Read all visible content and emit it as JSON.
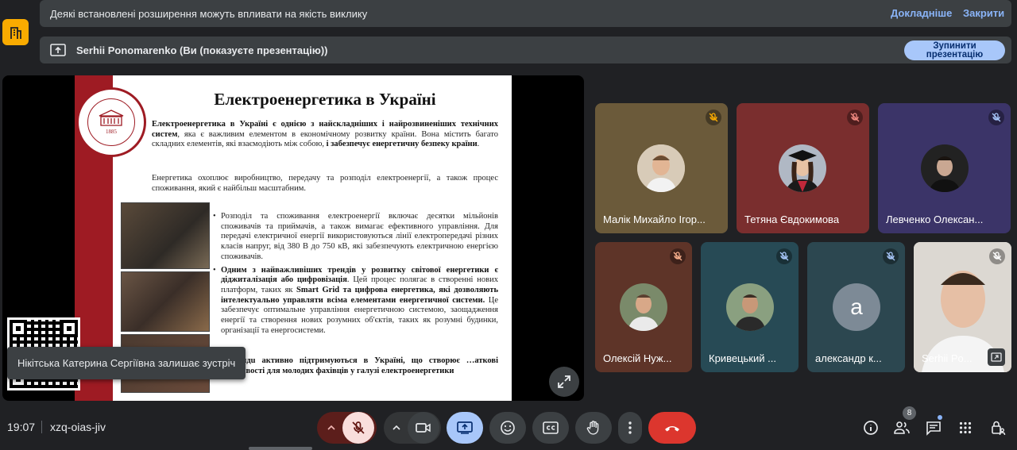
{
  "extensions_banner": {
    "text": "Деякі встановлені розширення можуть впливати на якість виклику",
    "details_link": "Докладніше",
    "close_link": "Закрити"
  },
  "presentation_banner": {
    "text": "Serhii Ponomarenko (Ви (показуєте презентацію))",
    "stop_line1": "Зупинити",
    "stop_line2": "презентацію"
  },
  "slide": {
    "title": "Електроенергетика в Україні",
    "logo_year": "1885",
    "p1_bold1": "Електроенергетика в Україні є однією з найскладніших і найрозвиненіших технічних систем",
    "p1_text1": ", яка є важливим елементом в економічному розвитку країни. Вона містить багато складних елементів, які взаємодіють між собою, ",
    "p1_bold2": "і забезпечує енергетичну безпеку країни",
    "p1_end": ".",
    "p2": "Енергетика охоплює виробництво, передачу та розподіл електроенергії, а також процес споживання, який є найбільш масштабним.",
    "b1": "Розподіл та споживання електроенергії включає десятки мільйонів споживачів та приймачів, а також вимагає ефективного управління. Для передачі електричної енергії використовуються лінії електропередачі різних класів напруг, від 380 В до 750 кВ, які забезпечують електричною енергією споживачів.",
    "b2_bold1": "Одним з найважливіших трендів у розвитку світової енергетики є діджиталізація або цифровізація",
    "b2_text1": ". Цей процес полягає в створенні нових платформ, таких як ",
    "b2_bold2": "Smart Grid та цифрова енергетика, які дозволяють інтелектуально управляти всіма елементами енергетичної системи.",
    "b2_text2": " Це забезпечує оптимальне управління енергетичною системою, заощадження енергії та створення нових розумних об'єктів, таких як розумні будинки, організації та енергосистеми.",
    "closing_bold": "…трендu активно підтримуються в Україні, що створює …аткові можливості для молодих фахівців у галузі електроенергетики"
  },
  "toast": {
    "text": "Нікітська Катерина Сергіївна залишає зустріч"
  },
  "participants": [
    {
      "name": "Малік Михайло Ігор...",
      "bg": "#6b5a3a"
    },
    {
      "name": "Тетяна Євдокимова",
      "bg": "#7a2e2e"
    },
    {
      "name": "Левченко Олексан...",
      "bg": "#3b3468"
    },
    {
      "name": "Олексій Нуж...",
      "bg": "#5e3428"
    },
    {
      "name": "Кривецький ...",
      "bg": "#274a55"
    },
    {
      "name": "александр к...",
      "bg": "#2c4750",
      "letter": "а"
    },
    {
      "name": "Serhii Po...",
      "bg": "#d8d4cf"
    }
  ],
  "bottom": {
    "time": "19:07",
    "meeting_code": "xzq-oias-jiv",
    "people_count": "8"
  },
  "colors": {
    "accent": "#a8c7fa",
    "end_call": "#dc362e",
    "muted_bg": "#f9dedc",
    "slide_red": "#9e1b23"
  }
}
